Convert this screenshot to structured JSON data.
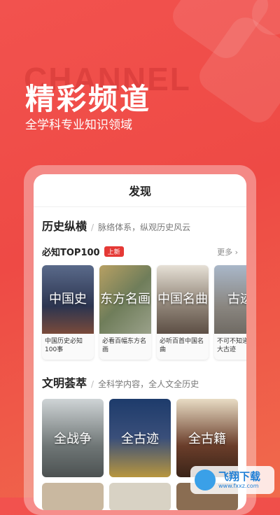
{
  "hero": {
    "watermark": "CHANNEL",
    "title": "精彩频道",
    "subtitle": "全学科专业知识领域"
  },
  "screen": {
    "header": "发现",
    "history": {
      "title": "历史纵横",
      "sep": "/",
      "desc": "脉络体系，纵观历史风云",
      "sub_title": "必知TOP100",
      "badge": "上新",
      "more": "更多 ›",
      "cards": [
        {
          "image_text": "中国史",
          "caption": "中国历史必知100事"
        },
        {
          "image_text": "东方名画",
          "caption": "必看百幅东方名画"
        },
        {
          "image_text": "中国名曲",
          "caption": "必听百首中国名曲"
        },
        {
          "image_text": "古迹",
          "caption": "不可不知道的百大古迹"
        }
      ]
    },
    "civilization": {
      "title": "文明荟萃",
      "sep": "/",
      "desc": "全科学内容，全人文全历史",
      "cards": [
        {
          "image_text": "全战争"
        },
        {
          "image_text": "全古迹"
        },
        {
          "image_text": "全古籍"
        }
      ]
    }
  },
  "watermark_logo": {
    "text": "飞翔下载",
    "url_text": "www.fxxz.com"
  },
  "colors": {
    "background": "#ee4a45",
    "badge": "#e53935",
    "logo": "#1f7fd6"
  }
}
